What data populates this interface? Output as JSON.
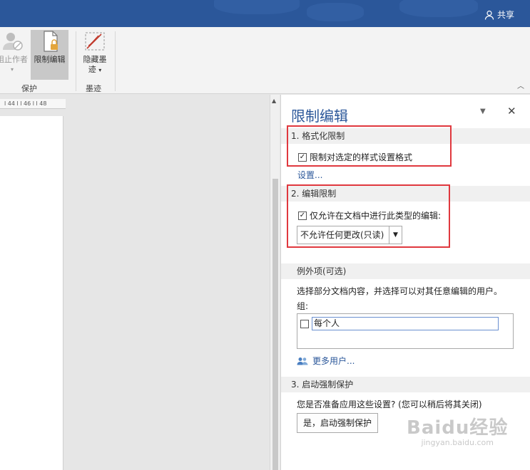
{
  "titlebar": {
    "share_label": "共享"
  },
  "ribbon": {
    "block_authors_label": "阻止作者",
    "restrict_editing_label": "限制编辑",
    "hide_ink_label": "隐藏墨",
    "hide_ink_label2": "迹",
    "group_protect": "保护",
    "group_ink": "墨迹"
  },
  "ruler": {
    "text": "l 44 l  l 46 l  l 48"
  },
  "pane": {
    "title": "限制编辑",
    "section1": "1. 格式化限制",
    "section1_check": "限制对选定的样式设置格式",
    "section1_checked": true,
    "settings_link": "设置...",
    "section2": "2. 编辑限制",
    "section2_check": "仅允许在文档中进行此类型的编辑:",
    "section2_checked": true,
    "edit_type_selected": "不允许任何更改(只读)",
    "exceptions_title": "例外项(可选)",
    "exceptions_desc": "选择部分文档内容，并选择可以对其任意编辑的用户。",
    "groups_label": "组:",
    "group_everyone": "每个人",
    "group_everyone_checked": false,
    "more_users_link": "更多用户...",
    "section3": "3. 启动强制保护",
    "section3_desc": "您是否准备应用这些设置? (您可以稍后将其关闭)",
    "start_button": "是，启动强制保护"
  },
  "watermark": {
    "brand": "Baidu经验",
    "url": "jingyan.baidu.com"
  },
  "colors": {
    "titlebar": "#2b579a",
    "accent": "#2b579a",
    "highlight": "#e0383e"
  }
}
